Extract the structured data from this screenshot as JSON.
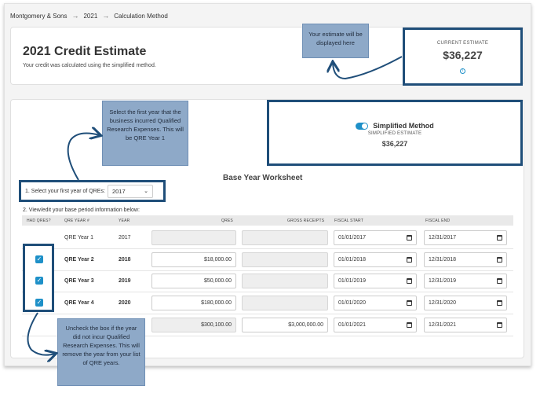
{
  "breadcrumb": {
    "items": [
      "Montgomery & Sons",
      "2021",
      "Calculation Method"
    ],
    "separator": "→"
  },
  "header": {
    "title": "2021 Credit Estimate",
    "subtitle": "Your credit was calculated using the simplified method."
  },
  "current_estimate": {
    "label": "CURRENT ESTIMATE",
    "value": "$36,227",
    "info_icon": "info-icon"
  },
  "method": {
    "toggle_on": true,
    "label": "Simplified Method",
    "sub_label": "SIMPLIFIED ESTIMATE",
    "value": "$36,227"
  },
  "worksheet": {
    "title": "Base Year Worksheet",
    "step1_label": "1. Select your first year of QREs:",
    "selected_year": "2017",
    "step2_label": "2. View/edit your base period information below:",
    "columns": [
      "HAD QRES?",
      "QRE YEAR #",
      "YEAR",
      "QRES",
      "GROSS RECEIPTS",
      "FISCAL START",
      "FISCAL END"
    ],
    "rows": [
      {
        "checked": false,
        "has_checkbox": false,
        "qre_year": "QRE Year 1",
        "year": "2017",
        "qres": "",
        "gross": "",
        "start": "01/01/2017",
        "end": "12/31/2017",
        "bold": false
      },
      {
        "checked": true,
        "has_checkbox": true,
        "qre_year": "QRE Year 2",
        "year": "2018",
        "qres": "$18,000.00",
        "gross": "",
        "start": "01/01/2018",
        "end": "12/31/2018",
        "bold": true
      },
      {
        "checked": true,
        "has_checkbox": true,
        "qre_year": "QRE Year 3",
        "year": "2019",
        "qres": "$50,000.00",
        "gross": "",
        "start": "01/01/2019",
        "end": "12/31/2019",
        "bold": true
      },
      {
        "checked": true,
        "has_checkbox": true,
        "qre_year": "QRE Year 4",
        "year": "2020",
        "qres": "$180,000.00",
        "gross": "",
        "start": "01/01/2020",
        "end": "12/31/2020",
        "bold": true
      }
    ],
    "total_row": {
      "qres": "$300,100.00",
      "gross": "$3,000,000.00",
      "start": "01/01/2021",
      "end": "12/31/2021"
    }
  },
  "callouts": {
    "estimate": "Your estimate will be displayed here",
    "first_year": "Select the first year that the business incurred Qualified Research Expenses. This will be QRE Year 1",
    "uncheck": "Uncheck the box if the year did not incur Qualified Research Expenses. This will remove the year from your list of QRE years."
  },
  "colors": {
    "accent": "#1e90c8",
    "annotation_border": "#1f4e79",
    "callout_bg": "#8ea9c8"
  }
}
